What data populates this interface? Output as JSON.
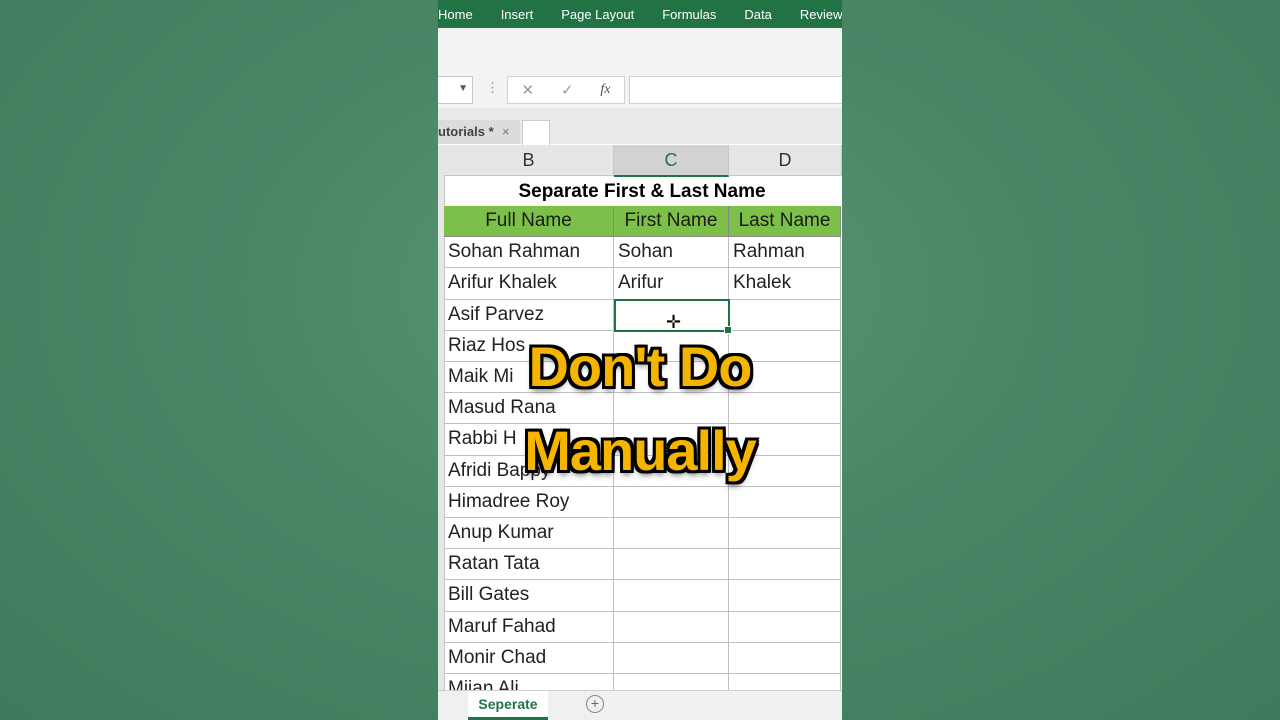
{
  "ribbon": {
    "tabs": [
      "Home",
      "Insert",
      "Page Layout",
      "Formulas",
      "Data",
      "Review"
    ]
  },
  "formula_bar": {
    "cancel_icon": "✕",
    "enter_icon": "✓",
    "fx_label": "fx",
    "value": ""
  },
  "doc_tab": {
    "label": "utorials *",
    "close": "×"
  },
  "columns": [
    "B",
    "C",
    "D"
  ],
  "selected_column": "C",
  "sheet": {
    "title": "Separate First & Last Name",
    "headers": [
      "Full Name",
      "First Name",
      "Last Name"
    ],
    "rows": [
      [
        "Sohan Rahman",
        "Sohan",
        "Rahman"
      ],
      [
        "Arifur Khalek",
        "Arifur",
        "Khalek"
      ],
      [
        "Asif Parvez",
        "",
        ""
      ],
      [
        "Riaz Hos",
        "",
        ""
      ],
      [
        "Maik Mi",
        "",
        ""
      ],
      [
        "Masud Rana",
        "",
        ""
      ],
      [
        "Rabbi H",
        "",
        ""
      ],
      [
        "Afridi Bappy",
        "",
        ""
      ],
      [
        "Himadree Roy",
        "",
        ""
      ],
      [
        "Anup Kumar",
        "",
        ""
      ],
      [
        "Ratan Tata",
        "",
        ""
      ],
      [
        "Bill Gates",
        "",
        ""
      ],
      [
        "Maruf Fahad",
        "",
        ""
      ],
      [
        "Monir Chad",
        "",
        ""
      ],
      [
        "Mijan Ali",
        "",
        ""
      ]
    ]
  },
  "sheet_tabs": {
    "active": "Seperate",
    "add_label": "+"
  },
  "overlay": {
    "line1": "Don't Do",
    "line2": "Manually"
  },
  "colors": {
    "excel_green": "#217346",
    "header_green": "#7cc04a",
    "overlay_text": "#f5b400"
  }
}
